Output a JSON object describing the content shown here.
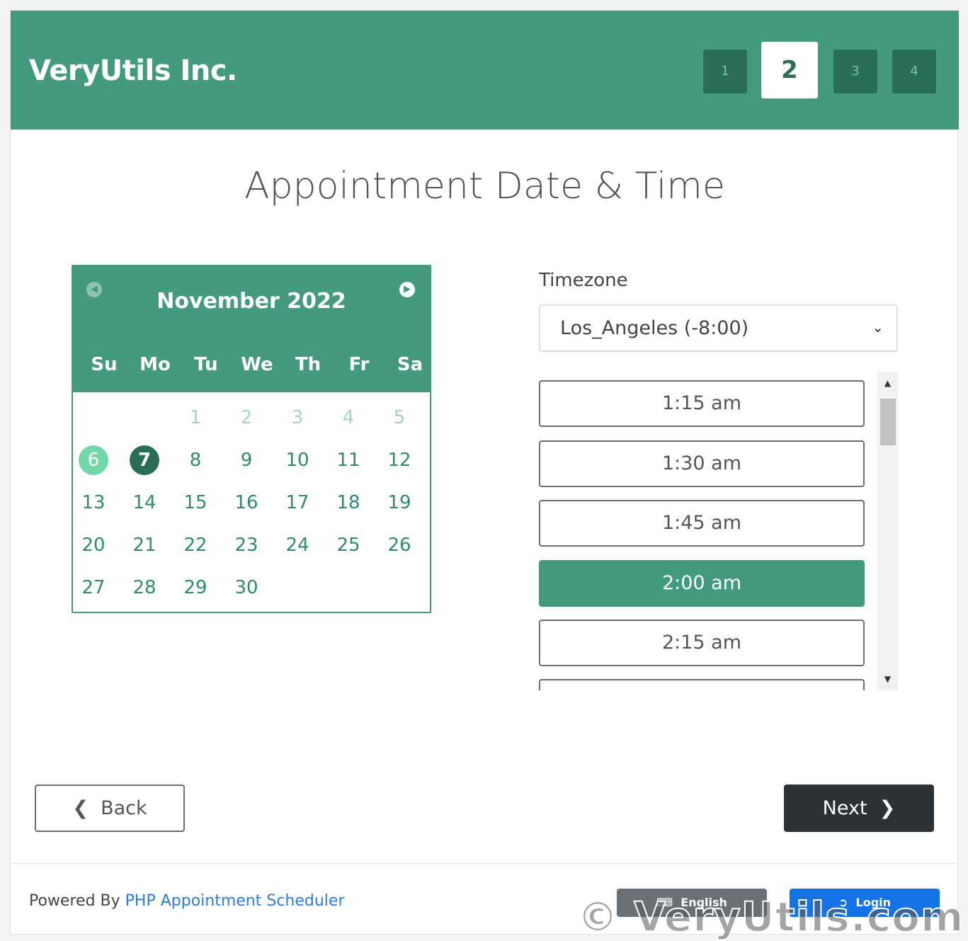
{
  "header": {
    "brand": "VeryUtils Inc.",
    "steps": [
      "1",
      "2",
      "3",
      "4"
    ],
    "active_step": "2"
  },
  "page": {
    "title": "Appointment Date & Time"
  },
  "calendar": {
    "month_label": "November 2022",
    "weekdays": [
      "Su",
      "Mo",
      "Tu",
      "We",
      "Th",
      "Fr",
      "Sa"
    ],
    "prev_icon": "chevron-left-icon",
    "next_icon": "chevron-right-icon",
    "today": "6",
    "selected": "7",
    "weeks": [
      [
        "",
        "",
        "1",
        "2",
        "3",
        "4",
        "5"
      ],
      [
        "6",
        "7",
        "8",
        "9",
        "10",
        "11",
        "12"
      ],
      [
        "13",
        "14",
        "15",
        "16",
        "17",
        "18",
        "19"
      ],
      [
        "20",
        "21",
        "22",
        "23",
        "24",
        "25",
        "26"
      ],
      [
        "27",
        "28",
        "29",
        "30",
        "",
        "",
        ""
      ]
    ],
    "disabled_days": [
      "1",
      "2",
      "3",
      "4",
      "5"
    ]
  },
  "timezone": {
    "label": "Timezone",
    "value": "Los_Angeles (-8:00)"
  },
  "time_slots": {
    "items": [
      "1:15 am",
      "1:30 am",
      "1:45 am",
      "2:00 am",
      "2:15 am"
    ],
    "selected": "2:00 am"
  },
  "nav": {
    "back_label": "Back",
    "next_label": "Next"
  },
  "footer": {
    "powered_by": "Powered By",
    "powered_link": "PHP Appointment Scheduler",
    "language_label": "English",
    "login_label": "Login"
  },
  "watermark": "© VeryUtils.com",
  "colors": {
    "primary": "#439a7e",
    "primary_dark": "#2b6e58",
    "today_highlight": "#74d7a7",
    "next_button": "#2c3136",
    "login_button": "#1473e6"
  }
}
